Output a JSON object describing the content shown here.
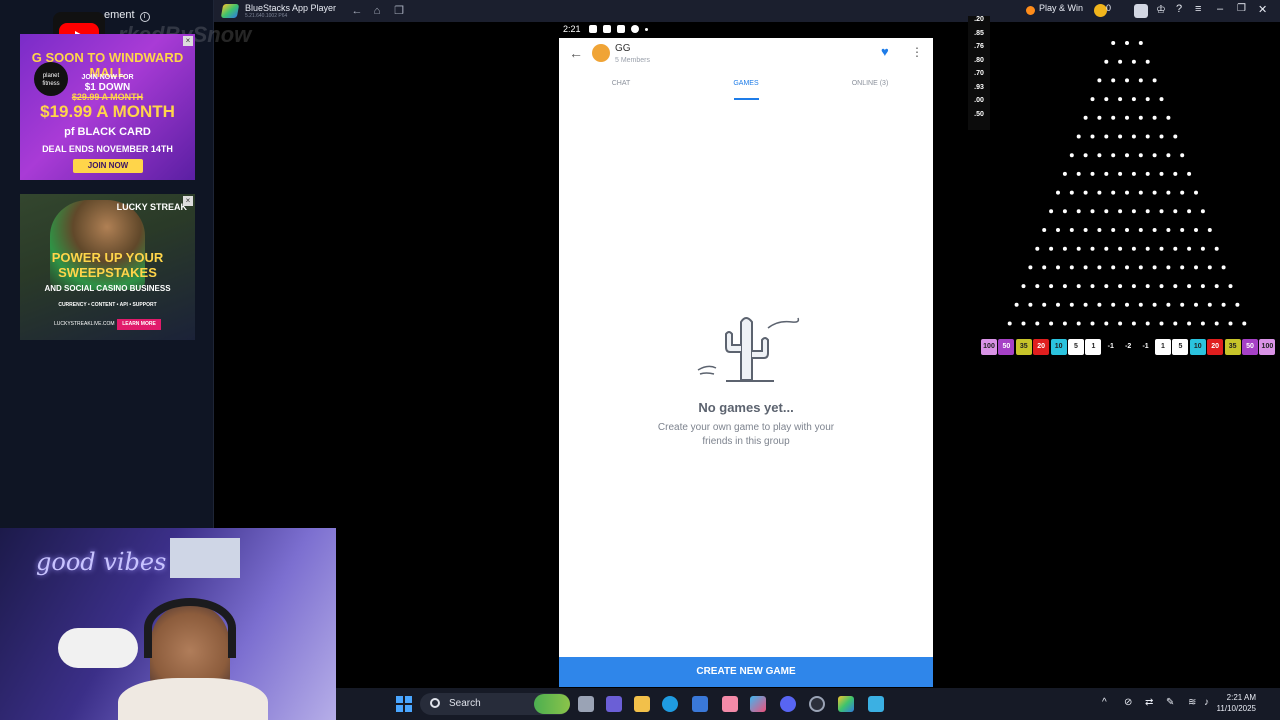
{
  "left_panel": {
    "ad_label": "ement",
    "watermark": "rkedBySnow",
    "ad1": {
      "line1": "G SOON TO WINDWARD MALL",
      "line2": "JOIN NOW FOR",
      "line3": "$1 DOWN",
      "line4": "$29.99 A MONTH",
      "line5": "$19.99 A MONTH",
      "line6": "pf BLACK CARD",
      "line7": "DEAL ENDS NOVEMBER 14TH",
      "button": "JOIN NOW",
      "logo": "planet fitness"
    },
    "ad2": {
      "brand": "LUCKY STREAK",
      "headline": "POWER UP YOUR SWEEPSTAKES",
      "sub": "AND SOCIAL CASINO BUSINESS",
      "features": "CURRENCY • CONTENT • API • SUPPORT",
      "url": "LUCKYSTREAKLIVE.COM",
      "button": "LEARN MORE"
    },
    "webcam_neon": "good vibes only"
  },
  "bluestacks": {
    "title": "BlueStacks App Player",
    "version": "5.21.640.1002 P64",
    "play_win": "Play & Win",
    "coins": "0"
  },
  "phone": {
    "time": "2:21",
    "group_name": "GG",
    "group_members": "5 Members",
    "tabs": [
      {
        "label": "CHAT"
      },
      {
        "label": "GAMES"
      },
      {
        "label": "ONLINE (3)"
      }
    ],
    "active_tab": "GAMES",
    "empty_title": "No games yet...",
    "empty_desc": "Create your own game to play with your friends in this group",
    "create_button": "CREATE NEW GAME"
  },
  "plinko": {
    "odds": [
      ".20",
      ".85",
      ".76",
      ".80",
      ".70",
      ".93",
      ".00",
      ".50"
    ],
    "slots": [
      {
        "label": "100",
        "color": "#d993e6"
      },
      {
        "label": "50",
        "color": "#a641c6"
      },
      {
        "label": "35",
        "color": "#c7c42a"
      },
      {
        "label": "20",
        "color": "#e01e1e"
      },
      {
        "label": "10",
        "color": "#2bc3de"
      },
      {
        "label": "5",
        "color": "#ffffff"
      },
      {
        "label": "1",
        "color": "#ffffff"
      },
      {
        "label": "-1",
        "color": ""
      },
      {
        "label": "-2",
        "color": ""
      },
      {
        "label": "-1",
        "color": ""
      },
      {
        "label": "1",
        "color": "#ffffff"
      },
      {
        "label": "5",
        "color": "#ffffff"
      },
      {
        "label": "10",
        "color": "#2bc3de"
      },
      {
        "label": "20",
        "color": "#e01e1e"
      },
      {
        "label": "35",
        "color": "#c7c42a"
      },
      {
        "label": "50",
        "color": "#a641c6"
      },
      {
        "label": "100",
        "color": "#d993e6"
      }
    ]
  },
  "taskbar": {
    "search": "Search",
    "time": "2:21 AM",
    "date": "11/10/2025"
  },
  "colors": {
    "accent": "#2f86ea",
    "tab_active": "#1e7ce8"
  }
}
